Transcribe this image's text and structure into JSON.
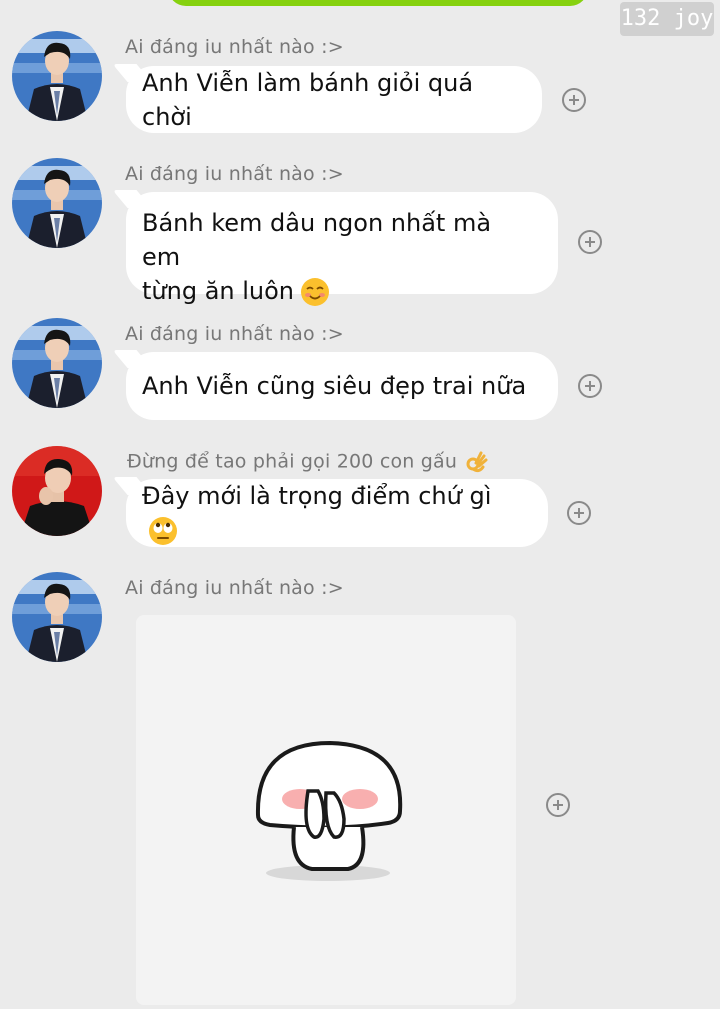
{
  "watermark": "132 joy",
  "messages": [
    {
      "sender": "Ai đáng iu nhất nào :>",
      "text": "Anh Viễn làm bánh giỏi quá chời",
      "avatar": "avatar-man-in-dark-suit"
    },
    {
      "sender": "Ai đáng iu nhất nào :>",
      "text": "Bánh kem dâu ngon nhất mà em\ntừng ăn luôn",
      "emoji": "smiling-face-emoji",
      "avatar": "avatar-man-in-dark-suit"
    },
    {
      "sender": "Ai đáng iu nhất nào :>",
      "text": "Anh Viễn cũng siêu đẹp trai nữa",
      "avatar": "avatar-man-in-dark-suit"
    },
    {
      "sender": "Đừng để tao phải gọi 200 con gấu",
      "sender_emoji": "ok-hand-emoji",
      "text": "Đây mới là trọng điểm chứ gì",
      "emoji": "rolling-eyes-emoji",
      "avatar": "avatar-man-on-red-background"
    },
    {
      "sender": "Ai đáng iu nhất nào :>",
      "sticker": "shy-bun-sticker",
      "avatar": "avatar-man-in-dark-suit"
    }
  ],
  "colors": {
    "background": "#ebebeb",
    "bubble": "#ffffff",
    "top_bar": "#86d10f",
    "name_text": "#777777"
  },
  "icons": {
    "reaction": "add-reaction-icon"
  }
}
